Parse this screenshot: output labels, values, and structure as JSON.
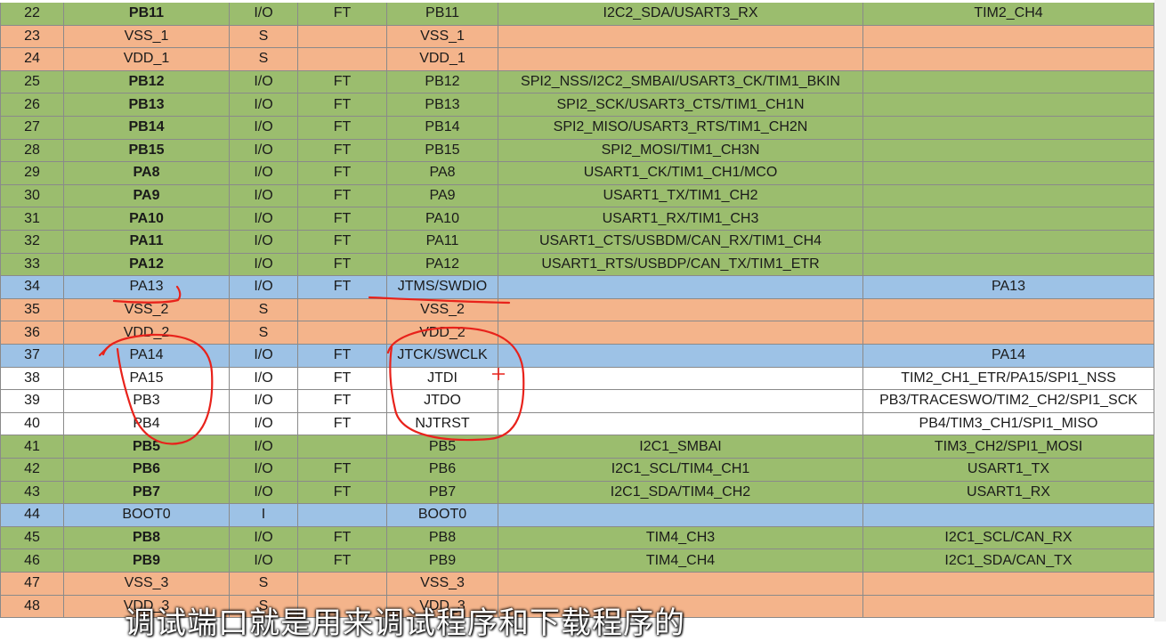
{
  "colors": {
    "green": "#9bbd6e",
    "orange": "#f4b48b",
    "blue": "#9dc2e6",
    "annotation": "#e8221b"
  },
  "rows": [
    {
      "num": "22",
      "pin": "PB11",
      "type": "I/O",
      "level": "FT",
      "main": "PB11",
      "default": "I2C2_SDA/USART3_RX",
      "remap": "TIM2_CH4",
      "color": "green",
      "bold": true
    },
    {
      "num": "23",
      "pin": "VSS_1",
      "type": "S",
      "level": "",
      "main": "VSS_1",
      "default": "",
      "remap": "",
      "color": "orange",
      "bold": false
    },
    {
      "num": "24",
      "pin": "VDD_1",
      "type": "S",
      "level": "",
      "main": "VDD_1",
      "default": "",
      "remap": "",
      "color": "orange",
      "bold": false
    },
    {
      "num": "25",
      "pin": "PB12",
      "type": "I/O",
      "level": "FT",
      "main": "PB12",
      "default": "SPI2_NSS/I2C2_SMBAI/USART3_CK/TIM1_BKIN",
      "remap": "",
      "color": "green",
      "bold": true
    },
    {
      "num": "26",
      "pin": "PB13",
      "type": "I/O",
      "level": "FT",
      "main": "PB13",
      "default": "SPI2_SCK/USART3_CTS/TIM1_CH1N",
      "remap": "",
      "color": "green",
      "bold": true
    },
    {
      "num": "27",
      "pin": "PB14",
      "type": "I/O",
      "level": "FT",
      "main": "PB14",
      "default": "SPI2_MISO/USART3_RTS/TIM1_CH2N",
      "remap": "",
      "color": "green",
      "bold": true
    },
    {
      "num": "28",
      "pin": "PB15",
      "type": "I/O",
      "level": "FT",
      "main": "PB15",
      "default": "SPI2_MOSI/TIM1_CH3N",
      "remap": "",
      "color": "green",
      "bold": true
    },
    {
      "num": "29",
      "pin": "PA8",
      "type": "I/O",
      "level": "FT",
      "main": "PA8",
      "default": "USART1_CK/TIM1_CH1/MCO",
      "remap": "",
      "color": "green",
      "bold": true
    },
    {
      "num": "30",
      "pin": "PA9",
      "type": "I/O",
      "level": "FT",
      "main": "PA9",
      "default": "USART1_TX/TIM1_CH2",
      "remap": "",
      "color": "green",
      "bold": true
    },
    {
      "num": "31",
      "pin": "PA10",
      "type": "I/O",
      "level": "FT",
      "main": "PA10",
      "default": "USART1_RX/TIM1_CH3",
      "remap": "",
      "color": "green",
      "bold": true
    },
    {
      "num": "32",
      "pin": "PA11",
      "type": "I/O",
      "level": "FT",
      "main": "PA11",
      "default": "USART1_CTS/USBDM/CAN_RX/TIM1_CH4",
      "remap": "",
      "color": "green",
      "bold": true
    },
    {
      "num": "33",
      "pin": "PA12",
      "type": "I/O",
      "level": "FT",
      "main": "PA12",
      "default": "USART1_RTS/USBDP/CAN_TX/TIM1_ETR",
      "remap": "",
      "color": "green",
      "bold": true
    },
    {
      "num": "34",
      "pin": "PA13",
      "type": "I/O",
      "level": "FT",
      "main": "JTMS/SWDIO",
      "default": "",
      "remap": "PA13",
      "color": "blue",
      "bold": false
    },
    {
      "num": "35",
      "pin": "VSS_2",
      "type": "S",
      "level": "",
      "main": "VSS_2",
      "default": "",
      "remap": "",
      "color": "orange",
      "bold": false
    },
    {
      "num": "36",
      "pin": "VDD_2",
      "type": "S",
      "level": "",
      "main": "VDD_2",
      "default": "",
      "remap": "",
      "color": "orange",
      "bold": false
    },
    {
      "num": "37",
      "pin": "PA14",
      "type": "I/O",
      "level": "FT",
      "main": "JTCK/SWCLK",
      "default": "",
      "remap": "PA14",
      "color": "blue",
      "bold": false
    },
    {
      "num": "38",
      "pin": "PA15",
      "type": "I/O",
      "level": "FT",
      "main": "JTDI",
      "default": "",
      "remap": "TIM2_CH1_ETR/PA15/SPI1_NSS",
      "color": "white",
      "bold": false
    },
    {
      "num": "39",
      "pin": "PB3",
      "type": "I/O",
      "level": "FT",
      "main": "JTDO",
      "default": "",
      "remap": "PB3/TRACESWO/TIM2_CH2/SPI1_SCK",
      "color": "white",
      "bold": false
    },
    {
      "num": "40",
      "pin": "PB4",
      "type": "I/O",
      "level": "FT",
      "main": "NJTRST",
      "default": "",
      "remap": "PB4/TIM3_CH1/SPI1_MISO",
      "color": "white",
      "bold": false
    },
    {
      "num": "41",
      "pin": "PB5",
      "type": "I/O",
      "level": "",
      "main": "PB5",
      "default": "I2C1_SMBAI",
      "remap": "TIM3_CH2/SPI1_MOSI",
      "color": "green",
      "bold": true
    },
    {
      "num": "42",
      "pin": "PB6",
      "type": "I/O",
      "level": "FT",
      "main": "PB6",
      "default": "I2C1_SCL/TIM4_CH1",
      "remap": "USART1_TX",
      "color": "green",
      "bold": true
    },
    {
      "num": "43",
      "pin": "PB7",
      "type": "I/O",
      "level": "FT",
      "main": "PB7",
      "default": "I2C1_SDA/TIM4_CH2",
      "remap": "USART1_RX",
      "color": "green",
      "bold": true
    },
    {
      "num": "44",
      "pin": "BOOT0",
      "type": "I",
      "level": "",
      "main": "BOOT0",
      "default": "",
      "remap": "",
      "color": "blue",
      "bold": false
    },
    {
      "num": "45",
      "pin": "PB8",
      "type": "I/O",
      "level": "FT",
      "main": "PB8",
      "default": "TIM4_CH3",
      "remap": "I2C1_SCL/CAN_RX",
      "color": "green",
      "bold": true
    },
    {
      "num": "46",
      "pin": "PB9",
      "type": "I/O",
      "level": "FT",
      "main": "PB9",
      "default": "TIM4_CH4",
      "remap": "I2C1_SDA/CAN_TX",
      "color": "green",
      "bold": true
    },
    {
      "num": "47",
      "pin": "VSS_3",
      "type": "S",
      "level": "",
      "main": "VSS_3",
      "default": "",
      "remap": "",
      "color": "orange",
      "bold": false
    },
    {
      "num": "48",
      "pin": "VDD_3",
      "type": "S",
      "level": "",
      "main": "VDD_3",
      "default": "",
      "remap": "",
      "color": "orange",
      "bold": false
    }
  ],
  "subtitle": "调试端口就是用来调试程序和下载程序的"
}
